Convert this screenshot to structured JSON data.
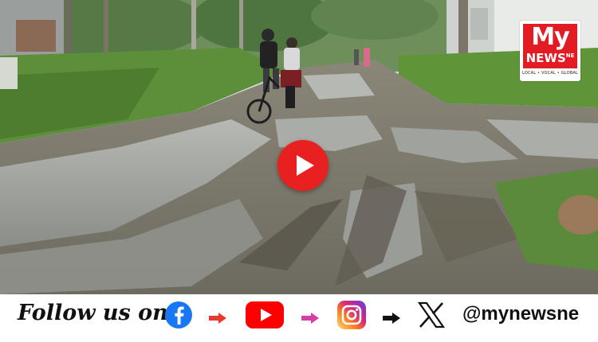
{
  "logo": {
    "wordmark_top": "My",
    "wordmark_bottom": "NEWS",
    "region_mark": "NE",
    "tagline": "LOCAL • VOCAL • GLOBAL",
    "brand_color": "#e31b23"
  },
  "player": {
    "play_icon": "play-icon",
    "play_color": "#e8201f"
  },
  "footer": {
    "follow_text": "Follow us on",
    "handle": "@mynewsne",
    "icons": [
      "facebook-icon",
      "youtube-icon",
      "instagram-icon",
      "x-icon"
    ],
    "arrow_colors": [
      "#e63b2e",
      "#d63fa8",
      "#111111"
    ],
    "facebook_color": "#1877f2",
    "youtube_color": "#ff0000"
  }
}
